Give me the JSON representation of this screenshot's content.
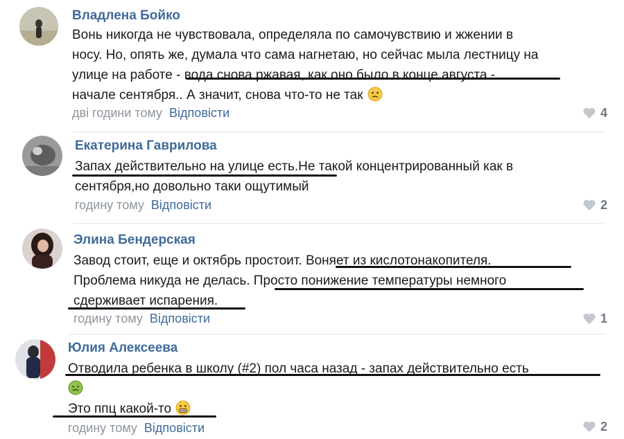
{
  "colors": {
    "author": "#3f6a9a",
    "reply": "#3f6a9a",
    "time": "#8d949c",
    "likes": "#6f7780",
    "underline": "#111111"
  },
  "comments": [
    {
      "author": "Владлена Бойко",
      "lines": [
        "Вонь никогда не чувствовала, определяла по самочувствию и жжении в",
        "носу. Но, опять же, думала что сама нагнетаю, но сейчас мыла лестницу на",
        "улице на работе - вода снова ржавая, как оно было в конце августа -",
        "начале сентября.. А значит, снова что-то не так"
      ],
      "emoji": "confused-face-emoji",
      "time": "дві години тому",
      "reply": "Відповісти",
      "likes": "4"
    },
    {
      "author": "Екатерина Гаврилова",
      "lines": [
        "Запах действительно на улице есть.Не такой концентрированный как в",
        "сентября,но довольно таки ощутимый"
      ],
      "time": "годину тому",
      "reply": "Відповісти",
      "likes": "2"
    },
    {
      "author": "Элина Бендерская",
      "lines": [
        "Завод стоит, еще и октябрь простоит. Воняет из кислотонакопителя.",
        "Проблема никуда не делась. Просто понижение температуры немного",
        "сдерживает испарения."
      ],
      "time": "годину тому",
      "reply": "Відповісти",
      "likes": "1"
    },
    {
      "author": "Юлия Алексеева",
      "lines": [
        "Отводила ребенка в школу (#2) пол часа назад - запах действительно есть",
        "",
        "Это ппц какой-то"
      ],
      "emoji_line2": "nauseated-face-emoji",
      "emoji_line3": "grimacing-face-emoji",
      "time": "годину тому",
      "reply": "Відповісти",
      "likes": "2"
    }
  ]
}
